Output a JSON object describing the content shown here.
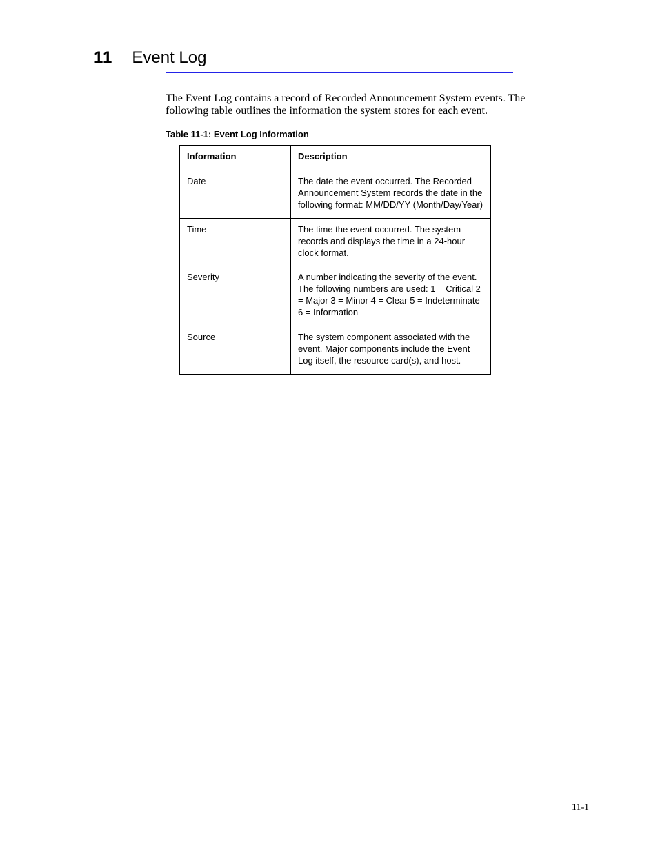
{
  "chapter": {
    "num_label": "11",
    "title": "Event Log"
  },
  "intro": "The Event Log contains a record of Recorded Announcement System events. The following table outlines the information the system stores for each event.",
  "table": {
    "title": "Table 11-1: Event Log Information",
    "headers": [
      "Information",
      "Description"
    ],
    "rows": [
      [
        "Date",
        "The date the event occurred. The Recorded Announcement System records the date in the following format:\nMM/DD/YY\n(Month/Day/Year)"
      ],
      [
        "Time",
        "The time the event occurred. The system records and displays the time in a 24-hour clock format."
      ],
      [
        "Severity",
        "A number indicating the severity of the event. The following numbers are used:\n1 = Critical\n2 = Major\n3 = Minor\n4 = Clear\n5 = Indeterminate\n6 = Information"
      ],
      [
        "Source",
        "The system component associated with the event. Major components include the Event Log itself, the resource card(s), and host."
      ]
    ]
  },
  "footer": "11-1"
}
